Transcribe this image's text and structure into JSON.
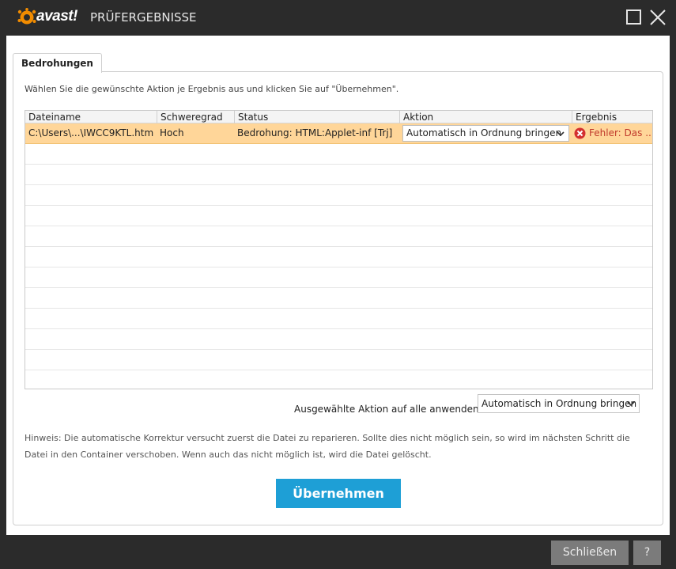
{
  "window": {
    "logo_text": "avast!",
    "title": "PRÜFERGEBNISSE"
  },
  "tabs": [
    {
      "label": "Bedrohungen"
    }
  ],
  "instruction": "Wählen Sie die gewünschte Aktion je Ergebnis aus und klicken Sie auf \"Übernehmen\".",
  "table": {
    "columns": [
      "Dateiname",
      "Schweregrad",
      "Status",
      "Aktion",
      "Ergebnis"
    ],
    "rows": [
      {
        "filename": "C:\\Users\\...\\IWCC9KTL.htm",
        "severity": "Hoch",
        "status": "Bedrohung: HTML:Applet-inf [Trj]",
        "action": "Automatisch in Ordnung bringen",
        "result": "Fehler: Das ...",
        "result_icon": "error-icon"
      }
    ]
  },
  "apply_all": {
    "label": "Ausgewählte Aktion auf alle anwenden:",
    "selected": "Automatisch in Ordnung bringen"
  },
  "hint": "Hinweis: Die automatische Korrektur versucht zuerst die Datei zu reparieren. Sollte dies nicht möglich sein, so wird im nächsten Schritt die Datei in den Container verschoben. Wenn auch das nicht möglich ist, wird die Datei gelöscht.",
  "buttons": {
    "apply": "Übernehmen",
    "close": "Schließen",
    "help": "?"
  },
  "colors": {
    "accent": "#1e9fd6",
    "logo_orange": "#f28c00",
    "selected_row": "#ffd699",
    "error": "#d32f2f",
    "titlebar": "#2b2b2b"
  }
}
